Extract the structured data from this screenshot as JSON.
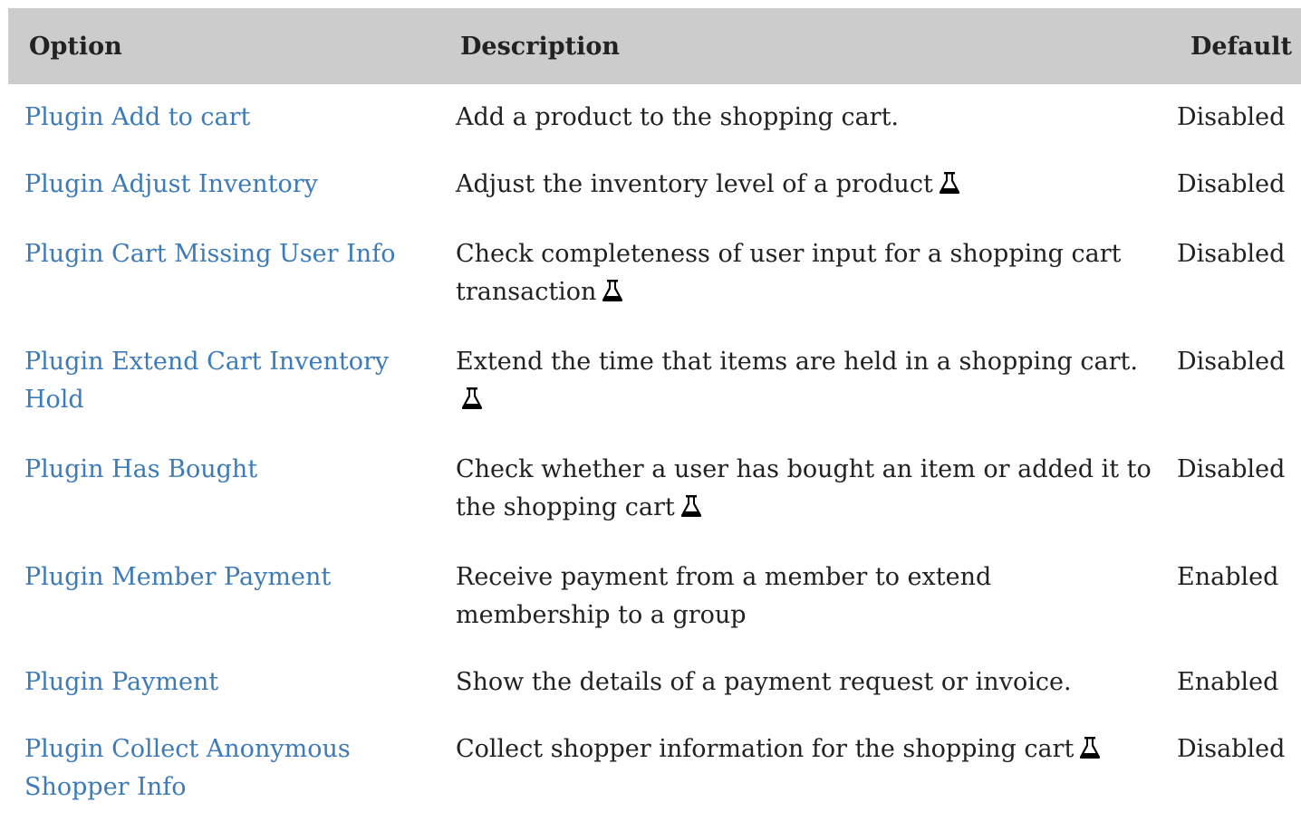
{
  "table": {
    "headers": {
      "option": "Option",
      "description": "Description",
      "default": "Default"
    },
    "colors": {
      "header_bg": "#cccccc",
      "link": "#3d7bb8",
      "text": "#212121"
    },
    "rows": [
      {
        "option": "Plugin Add to cart",
        "description": "Add a product to the shopping cart.",
        "experimental": false,
        "default": "Disabled"
      },
      {
        "option": "Plugin Adjust Inventory",
        "description": "Adjust the inventory level of a product",
        "experimental": true,
        "default": "Disabled"
      },
      {
        "option": "Plugin Cart Missing User Info",
        "description": "Check completeness of user input for a shopping cart transaction",
        "experimental": true,
        "default": "Disabled"
      },
      {
        "option": "Plugin Extend Cart Inventory Hold",
        "description": "Extend the time that items are held in a shopping cart.",
        "experimental": true,
        "default": "Disabled"
      },
      {
        "option": "Plugin Has Bought",
        "description": "Check whether a user has bought an item or added it to the shopping cart",
        "experimental": true,
        "default": "Disabled"
      },
      {
        "option": "Plugin Member Payment",
        "description": "Receive payment from a member to extend membership to a group",
        "experimental": false,
        "default": "Enabled"
      },
      {
        "option": "Plugin Payment",
        "description": "Show the details of a payment request or invoice.",
        "experimental": false,
        "default": "Enabled"
      },
      {
        "option": "Plugin Collect Anonymous Shopper Info",
        "description": "Collect shopper information for the shopping cart",
        "experimental": true,
        "default": "Disabled"
      }
    ],
    "experimental_icon": "flask-icon"
  }
}
